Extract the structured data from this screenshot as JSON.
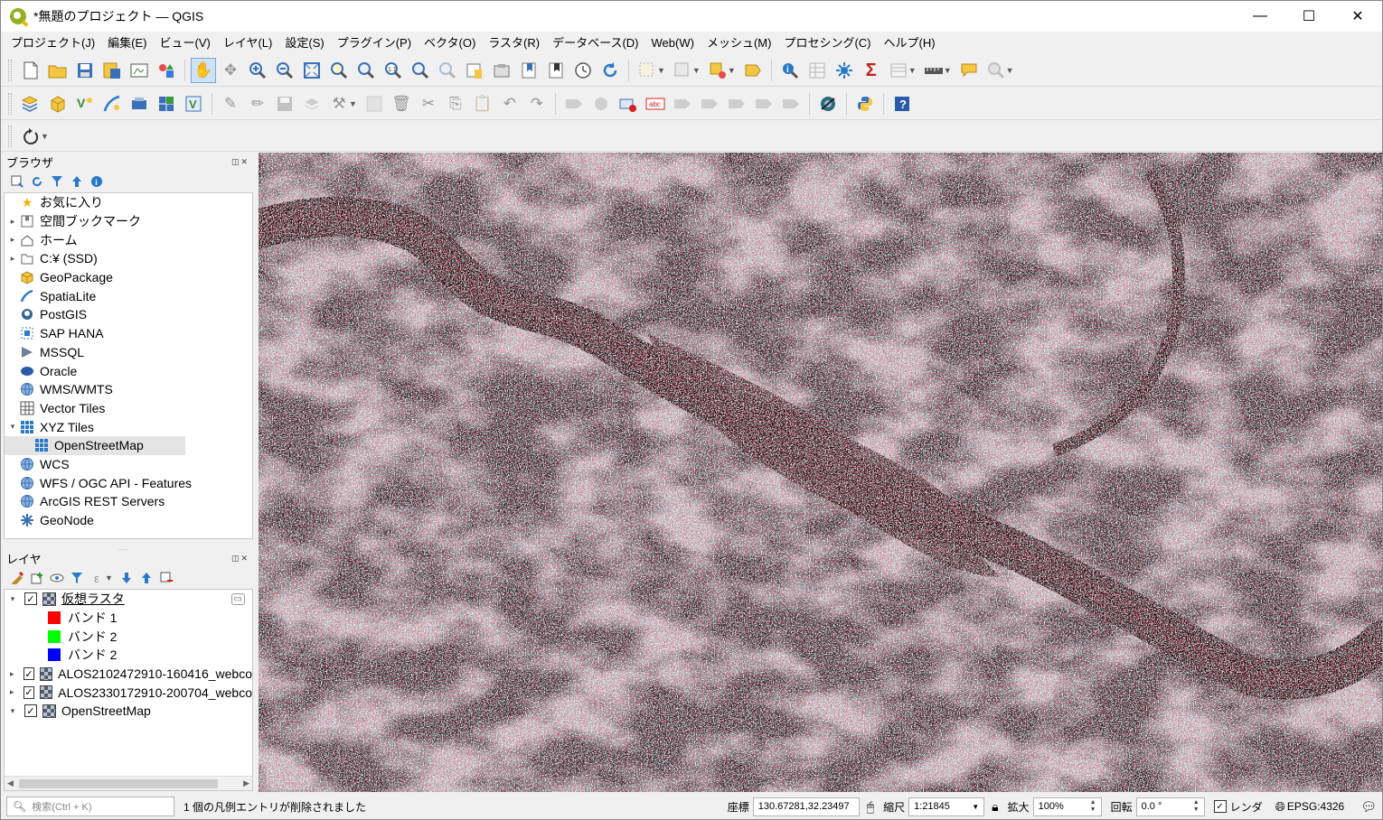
{
  "window": {
    "title": "*無題のプロジェクト — QGIS",
    "minimize": "—",
    "maximize": "☐",
    "close": "✕"
  },
  "menu": [
    "プロジェクト(J)",
    "編集(E)",
    "ビュー(V)",
    "レイヤ(L)",
    "設定(S)",
    "プラグイン(P)",
    "ベクタ(O)",
    "ラスタ(R)",
    "データベース(D)",
    "Web(W)",
    "メッシュ(M)",
    "プロセシング(C)",
    "ヘルプ(H)"
  ],
  "toolbar_icons": {
    "row1": [
      "new-project",
      "open-project",
      "save-project",
      "save-as",
      "print-layout",
      "style-manager",
      "pan",
      "pan-to-selection",
      "zoom-in",
      "zoom-out",
      "zoom-full",
      "zoom-to-selection",
      "zoom-to-layer",
      "zoom-native",
      "zoom-last",
      "zoom-next",
      "new-bookmark",
      "show-bookmarks",
      "temporal-controller",
      "refresh",
      "select-features",
      "deselect",
      "attribute-table-new",
      "measure-select",
      "identify",
      "attribute-table",
      "statistics",
      "field-calculator",
      "sum",
      "open-table",
      "measure",
      "annotation",
      "map-tips",
      "locate"
    ],
    "row2": [
      "data-source-manager",
      "new-geopackage",
      "new-shapefile",
      "new-spatialite",
      "new-virtual",
      "new-mesh",
      "new-temporary",
      "digitize",
      "edit-pencil",
      "save-edits",
      "add-feature",
      "vertex-tool",
      "modify-attributes",
      "delete-selected",
      "cut",
      "copy",
      "paste",
      "undo",
      "redo",
      "label-tool",
      "pin-labels",
      "highlight-labels",
      "show-hide-labels",
      "move-label",
      "rotate-label",
      "change-label",
      "label-props",
      "python",
      "plugins-globe",
      "help"
    ],
    "row3": [
      "spin-tool"
    ]
  },
  "browser": {
    "title": "ブラウザ",
    "items": [
      {
        "label": "お気に入り",
        "icon": "star",
        "arrow": "",
        "indent": 0
      },
      {
        "label": "空間ブックマーク",
        "icon": "bookmark",
        "arrow": "▸",
        "indent": 0
      },
      {
        "label": "ホーム",
        "icon": "home",
        "arrow": "▸",
        "indent": 0
      },
      {
        "label": "C:¥ (SSD)",
        "icon": "drive",
        "arrow": "▸",
        "indent": 0
      },
      {
        "label": "GeoPackage",
        "icon": "geopackage",
        "arrow": "",
        "indent": 0
      },
      {
        "label": "SpatiaLite",
        "icon": "spatialite",
        "arrow": "",
        "indent": 0
      },
      {
        "label": "PostGIS",
        "icon": "postgis",
        "arrow": "",
        "indent": 0
      },
      {
        "label": "SAP HANA",
        "icon": "hana",
        "arrow": "",
        "indent": 0
      },
      {
        "label": "MSSQL",
        "icon": "mssql",
        "arrow": "",
        "indent": 0
      },
      {
        "label": "Oracle",
        "icon": "oracle",
        "arrow": "",
        "indent": 0
      },
      {
        "label": "WMS/WMTS",
        "icon": "globe",
        "arrow": "",
        "indent": 0
      },
      {
        "label": "Vector Tiles",
        "icon": "grid",
        "arrow": "",
        "indent": 0
      },
      {
        "label": "XYZ Tiles",
        "icon": "tiles",
        "arrow": "▾",
        "indent": 0
      },
      {
        "label": "OpenStreetMap",
        "icon": "tiles",
        "arrow": "",
        "indent": 1
      },
      {
        "label": "WCS",
        "icon": "globe",
        "arrow": "",
        "indent": 0
      },
      {
        "label": "WFS / OGC API - Features",
        "icon": "globe",
        "arrow": "",
        "indent": 0
      },
      {
        "label": "ArcGIS REST Servers",
        "icon": "globe",
        "arrow": "",
        "indent": 0
      },
      {
        "label": "GeoNode",
        "icon": "geonode",
        "arrow": "",
        "indent": 0
      }
    ]
  },
  "layers": {
    "title": "レイヤ",
    "items": [
      {
        "label": "仮想ラスタ",
        "type": "layer",
        "arrow": "▾",
        "checked": true
      },
      {
        "label": "バンド 1",
        "type": "band",
        "color": "#ff0000"
      },
      {
        "label": "バンド 2",
        "type": "band",
        "color": "#00ff00"
      },
      {
        "label": "バンド 2",
        "type": "band",
        "color": "#0000ff"
      },
      {
        "label": "ALOS2102472910-160416_webco",
        "type": "layer",
        "arrow": "▸",
        "checked": true
      },
      {
        "label": "ALOS2330172910-200704_webco",
        "type": "layer",
        "arrow": "▸",
        "checked": true
      },
      {
        "label": "OpenStreetMap",
        "type": "layer",
        "arrow": "▾",
        "checked": true
      }
    ]
  },
  "status": {
    "search_placeholder": "検索(Ctrl + K)",
    "message": "1 個の凡例エントリが削除されました",
    "coord_label": "座標",
    "coord_value": "130.67281,32.23497",
    "scale_label": "縮尺",
    "scale_value": "1:21845",
    "magnifier_label": "拡大",
    "magnifier_value": "100%",
    "rotation_label": "回転",
    "rotation_value": "0.0 °",
    "render_label": "レンダ",
    "crs": "EPSG:4326"
  },
  "colors": {
    "band_red": "#ff0000",
    "band_green": "#00ff00",
    "band_blue": "#0000ff",
    "sar_red": "#d8142a",
    "sar_cyan": "#56e0e0"
  }
}
